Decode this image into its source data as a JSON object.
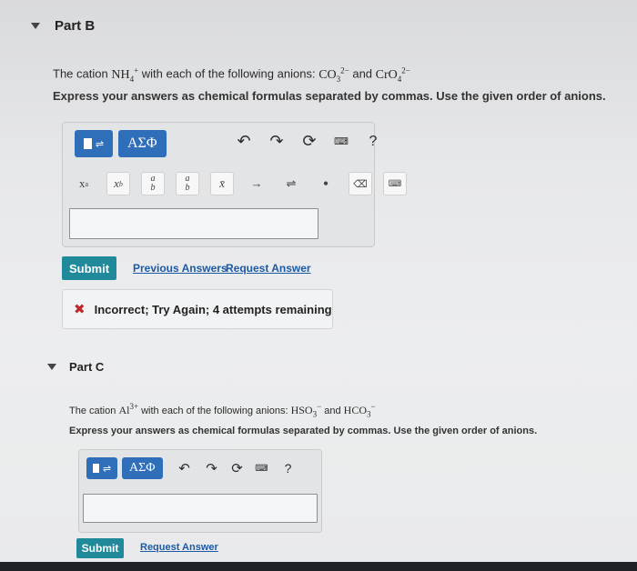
{
  "partB": {
    "title": "Part B",
    "prompt_lead": "The cation",
    "cation": {
      "base": "NH",
      "sub": "4",
      "sup": "+"
    },
    "prompt_mid": "with each of the following anions:",
    "anion1": {
      "base": "CO",
      "sub": "3",
      "sup": "2−"
    },
    "prompt_and": "and",
    "anion2": {
      "base": "CrO",
      "sub": "4",
      "sup": "2−"
    },
    "instruction": "Express your answers as chemical formulas separated by commas. Use the given order of anions.",
    "toolbar": {
      "greek_label": "ΑΣΦ",
      "help_label": "?",
      "keys": [
        "x^a",
        "x_b",
        "a/b",
        "a/b",
        "x̄",
        "→",
        "⇌",
        "•"
      ]
    },
    "answer_value": "",
    "submit_label": "Submit",
    "previous_answers_label": "Previous Answers",
    "request_answer_label": "Request Answer",
    "feedback": "Incorrect; Try Again; 4 attempts remaining"
  },
  "partC": {
    "title": "Part C",
    "prompt_lead": "The cation",
    "cation": {
      "base": "Al",
      "sub": "",
      "sup": "3+"
    },
    "prompt_mid": "with each of the following anions:",
    "anion1": {
      "base": "HSO",
      "sub": "3",
      "sup": "−"
    },
    "prompt_and": "and",
    "anion2": {
      "base": "HCO",
      "sub": "3",
      "sup": "−"
    },
    "instruction": "Express your answers as chemical formulas separated by commas. Use the given order of anions.",
    "toolbar": {
      "greek_label": "ΑΣΦ",
      "help_label": "?"
    },
    "answer_value": "",
    "submit_label": "Submit",
    "request_answer_label": "Request Answer"
  },
  "colors": {
    "accent_blue": "#2f6fba",
    "submit_teal": "#218a9a",
    "error_red": "#c0272d",
    "link_blue": "#1c5aa6"
  }
}
